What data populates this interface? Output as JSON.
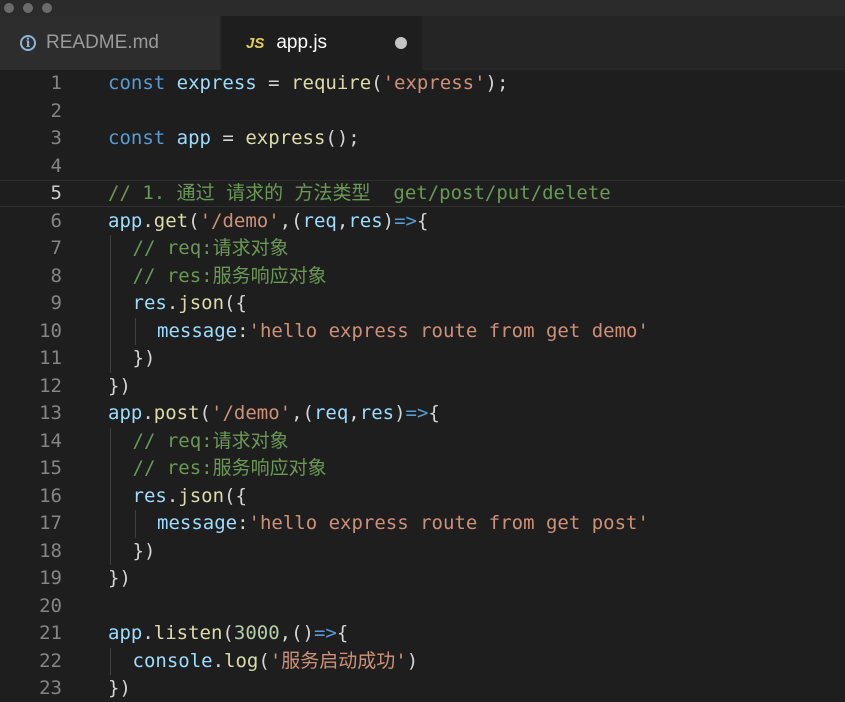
{
  "tabs": [
    {
      "label": "README.md",
      "icon": "info-icon"
    },
    {
      "label": "app.js",
      "icon": "js-icon",
      "icon_text": "JS",
      "unsaved": true
    }
  ],
  "editor": {
    "current_line": 5,
    "lines": [
      {
        "n": "1",
        "indent": 0,
        "tokens": [
          [
            "k",
            "const"
          ],
          [
            "p",
            " "
          ],
          [
            "v",
            "express"
          ],
          [
            "p",
            " = "
          ],
          [
            "f",
            "require"
          ],
          [
            "p",
            "("
          ],
          [
            "s",
            "'express'"
          ],
          [
            "p",
            ");"
          ]
        ]
      },
      {
        "n": "2",
        "indent": 0,
        "tokens": []
      },
      {
        "n": "3",
        "indent": 0,
        "tokens": [
          [
            "k",
            "const"
          ],
          [
            "p",
            " "
          ],
          [
            "v",
            "app"
          ],
          [
            "p",
            " = "
          ],
          [
            "f",
            "express"
          ],
          [
            "p",
            "();"
          ]
        ]
      },
      {
        "n": "4",
        "indent": 0,
        "tokens": []
      },
      {
        "n": "5",
        "indent": 0,
        "tokens": [
          [
            "c",
            "// 1. 通过 请求的 方法类型  get/post/put/delete"
          ]
        ]
      },
      {
        "n": "6",
        "indent": 0,
        "tokens": [
          [
            "v",
            "app"
          ],
          [
            "p",
            "."
          ],
          [
            "f",
            "get"
          ],
          [
            "p",
            "("
          ],
          [
            "s",
            "'/demo'"
          ],
          [
            "p",
            ",("
          ],
          [
            "v",
            "req"
          ],
          [
            "p",
            ","
          ],
          [
            "v",
            "res"
          ],
          [
            "p",
            ")"
          ],
          [
            "k",
            "=>"
          ],
          [
            "p",
            "{"
          ]
        ]
      },
      {
        "n": "7",
        "indent": 1,
        "tokens": [
          [
            "c",
            "// req:请求对象"
          ]
        ]
      },
      {
        "n": "8",
        "indent": 1,
        "tokens": [
          [
            "c",
            "// res:服务响应对象"
          ]
        ]
      },
      {
        "n": "9",
        "indent": 1,
        "tokens": [
          [
            "v",
            "res"
          ],
          [
            "p",
            "."
          ],
          [
            "f",
            "json"
          ],
          [
            "p",
            "({"
          ]
        ]
      },
      {
        "n": "10",
        "indent": 2,
        "tokens": [
          [
            "v",
            "message"
          ],
          [
            "p",
            ":"
          ],
          [
            "s",
            "'hello express route from get demo'"
          ]
        ]
      },
      {
        "n": "11",
        "indent": 1,
        "tokens": [
          [
            "p",
            "})"
          ]
        ]
      },
      {
        "n": "12",
        "indent": 0,
        "tokens": [
          [
            "p",
            "})"
          ]
        ]
      },
      {
        "n": "13",
        "indent": 0,
        "tokens": [
          [
            "v",
            "app"
          ],
          [
            "p",
            "."
          ],
          [
            "f",
            "post"
          ],
          [
            "p",
            "("
          ],
          [
            "s",
            "'/demo'"
          ],
          [
            "p",
            ",("
          ],
          [
            "v",
            "req"
          ],
          [
            "p",
            ","
          ],
          [
            "v",
            "res"
          ],
          [
            "p",
            ")"
          ],
          [
            "k",
            "=>"
          ],
          [
            "p",
            "{"
          ]
        ]
      },
      {
        "n": "14",
        "indent": 1,
        "tokens": [
          [
            "c",
            "// req:请求对象"
          ]
        ]
      },
      {
        "n": "15",
        "indent": 1,
        "tokens": [
          [
            "c",
            "// res:服务响应对象"
          ]
        ]
      },
      {
        "n": "16",
        "indent": 1,
        "tokens": [
          [
            "v",
            "res"
          ],
          [
            "p",
            "."
          ],
          [
            "f",
            "json"
          ],
          [
            "p",
            "({"
          ]
        ]
      },
      {
        "n": "17",
        "indent": 2,
        "tokens": [
          [
            "v",
            "message"
          ],
          [
            "p",
            ":"
          ],
          [
            "s",
            "'hello express route from get post'"
          ]
        ]
      },
      {
        "n": "18",
        "indent": 1,
        "tokens": [
          [
            "p",
            "})"
          ]
        ]
      },
      {
        "n": "19",
        "indent": 0,
        "tokens": [
          [
            "p",
            "})"
          ]
        ]
      },
      {
        "n": "20",
        "indent": 0,
        "tokens": []
      },
      {
        "n": "21",
        "indent": 0,
        "tokens": [
          [
            "v",
            "app"
          ],
          [
            "p",
            "."
          ],
          [
            "f",
            "listen"
          ],
          [
            "p",
            "("
          ],
          [
            "n",
            "3000"
          ],
          [
            "p",
            ",()"
          ],
          [
            "k",
            "=>"
          ],
          [
            "p",
            "{"
          ]
        ]
      },
      {
        "n": "22",
        "indent": 1,
        "tokens": [
          [
            "v",
            "console"
          ],
          [
            "p",
            "."
          ],
          [
            "f",
            "log"
          ],
          [
            "p",
            "("
          ],
          [
            "s",
            "'服务启动成功'"
          ],
          [
            "p",
            ")"
          ]
        ]
      },
      {
        "n": "23",
        "indent": 0,
        "tokens": [
          [
            "p",
            "})"
          ]
        ]
      }
    ]
  }
}
